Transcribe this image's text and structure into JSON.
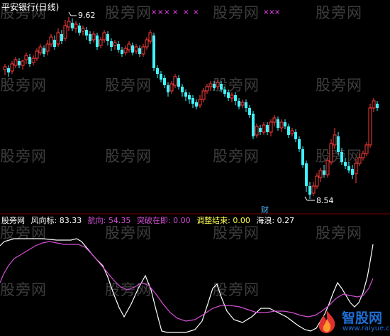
{
  "watermark_text": "股旁网",
  "header": {
    "title": "平安银行(日线)"
  },
  "main_chart": {
    "high_label": "9.62",
    "low_label": "8.54",
    "finance_marker": "财",
    "marker_glyph": "×",
    "colors": {
      "up": "#ff3b3b",
      "down": "#3ff6ff",
      "marker": "#ff44ff",
      "label": "#ffffff"
    }
  },
  "indicator": {
    "name": "股旁网",
    "items": [
      {
        "label": "风向标:",
        "value": "83.33",
        "color": "#ffffff"
      },
      {
        "label": "航向:",
        "value": "54.35",
        "color": "#d64fd6"
      },
      {
        "label": "突破在即:",
        "value": "0.00",
        "color": "#d64fd6"
      },
      {
        "label": "调整结束:",
        "value": "0.00",
        "color": "#ffff54"
      },
      {
        "label": "海浪:",
        "value": "0.27",
        "color": "#ffffff"
      }
    ]
  },
  "logo": {
    "name": "智股网",
    "url": "www.raiyue.com"
  }
}
